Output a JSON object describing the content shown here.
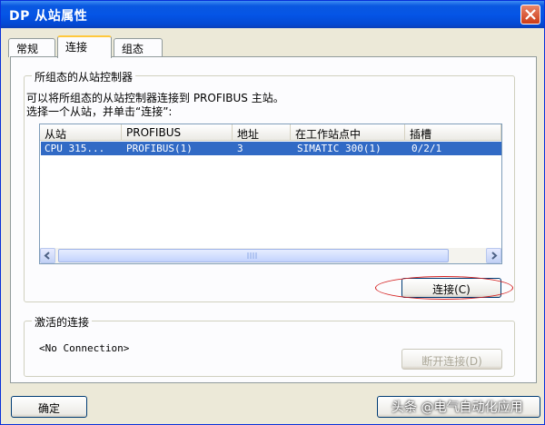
{
  "window": {
    "title": "DP 从站属性"
  },
  "tabs": [
    {
      "label": "常规",
      "active": false
    },
    {
      "label": "连接",
      "active": true
    },
    {
      "label": "组态",
      "active": false
    }
  ],
  "configured_group": {
    "title": "所组态的从站控制器",
    "desc_line1": "可以将所组态的从站控制器连接到 PROFIBUS 主站。",
    "desc_line2": "选择一个从站，并单击“连接”:"
  },
  "table": {
    "columns": [
      "从站",
      "PROFIBUS",
      "地址",
      "在工作站点中",
      "插槽"
    ],
    "rows": [
      [
        "CPU 315...",
        "PROFIBUS(1)",
        "3",
        "SIMATIC 300(1)",
        "0/2/1"
      ]
    ]
  },
  "buttons": {
    "connect": "连接(C)",
    "disconnect": "断开连接(D)",
    "ok": "确定"
  },
  "active_group": {
    "title": "激活的连接",
    "value": "<No Connection>"
  },
  "watermark": "头条 @电气自动化应用",
  "colors": {
    "title_bar": "#0555e6",
    "selection": "#316ac5",
    "highlight_oval": "#d42020"
  }
}
